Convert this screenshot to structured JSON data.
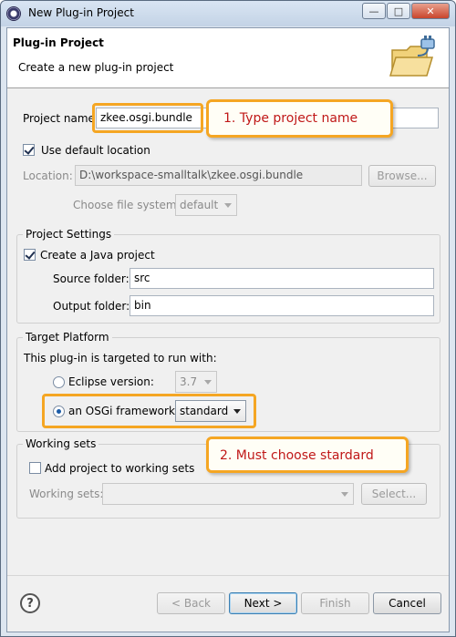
{
  "window": {
    "title": "New Plug-in Project",
    "controls": [
      "minimize-icon",
      "maximize-icon",
      "close-icon"
    ]
  },
  "banner": {
    "title": "Plug-in Project",
    "description": "Create a new plug-in project",
    "icon": "plugin-folder-icon"
  },
  "project": {
    "name_label": "Project name:",
    "name_value": "zkee.osgi.bundle",
    "use_default_label": "Use default location",
    "location_label": "Location:",
    "location_value": "D:\\workspace-smalltalk\\zkee.osgi.bundle",
    "browse_label": "Browse...",
    "filesystem_label": "Choose file system:",
    "filesystem_value": "default"
  },
  "settings": {
    "title": "Project Settings",
    "java_label": "Create a Java project",
    "source_label": "Source folder:",
    "source_value": "src",
    "output_label": "Output folder:",
    "output_value": "bin"
  },
  "target": {
    "title": "Target Platform",
    "intro": "This plug-in is targeted to run with:",
    "eclipse_label": "Eclipse version:",
    "eclipse_value": "3.7",
    "osgi_label": "an OSGi framework:",
    "osgi_value": "standard"
  },
  "working_sets": {
    "title": "Working sets",
    "add_label": "Add project to working sets",
    "sets_label": "Working sets:",
    "select_label": "Select..."
  },
  "annotations": {
    "step1": "1. Type project name",
    "step2": "2. Must choose stardard",
    "accent": "#f5a623",
    "text_color": "#c01818"
  },
  "footer": {
    "back": "< Back",
    "next": "Next >",
    "finish": "Finish",
    "cancel": "Cancel",
    "help_icon": "help-icon"
  }
}
